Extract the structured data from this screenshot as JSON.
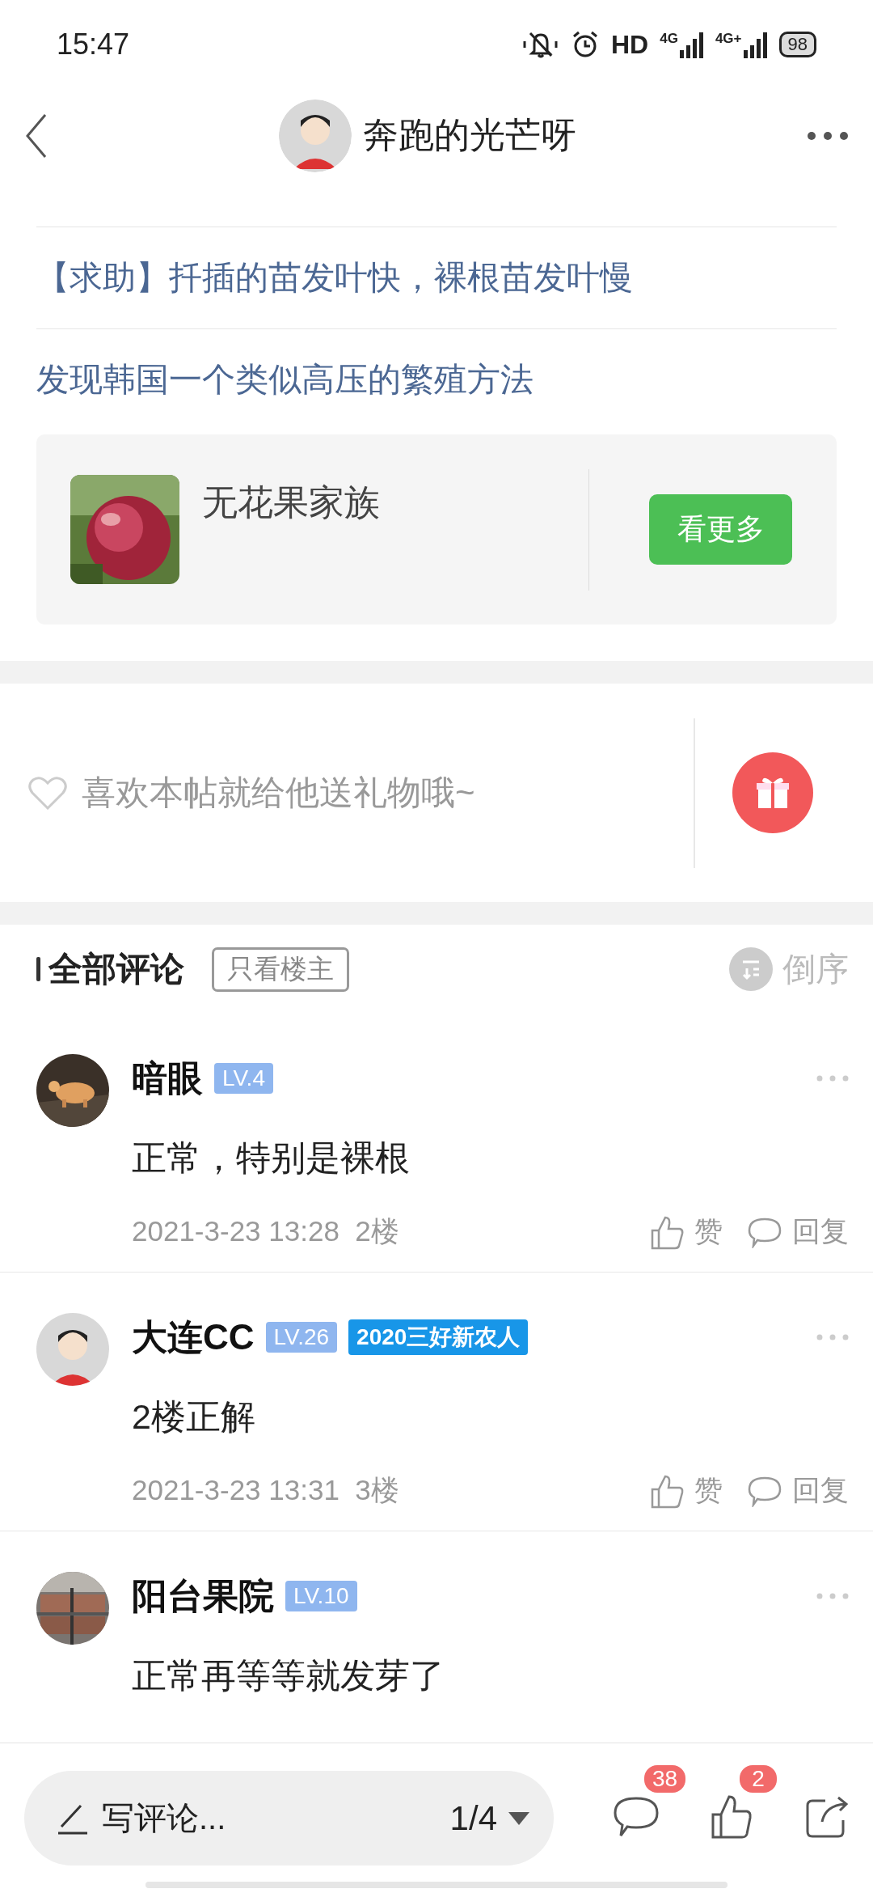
{
  "status_bar": {
    "time": "15:47",
    "hd": "HD",
    "networks": [
      "4G",
      "4G+"
    ],
    "battery": "98"
  },
  "header": {
    "title": "奔跑的光芒呀"
  },
  "related_links": [
    {
      "text": "【求助】扦插的苗发叶快，裸根苗发叶慢"
    },
    {
      "text": "发现韩国一个类似高压的繁殖方法"
    }
  ],
  "forum_card": {
    "name": "无花果家族",
    "button": "看更多"
  },
  "gift": {
    "prompt": "喜欢本帖就给他送礼物哦~"
  },
  "comments_header": {
    "title": "全部评论",
    "filter": "只看楼主",
    "sort": "倒序"
  },
  "comments": [
    {
      "user": "暗眼",
      "badges": [
        {
          "kind": "level",
          "text": "LV.4"
        }
      ],
      "text": "正常，特别是裸根",
      "time": "2021-3-23 13:28",
      "floor": "2楼",
      "like": "赞",
      "reply": "回复"
    },
    {
      "user": "大连CC",
      "badges": [
        {
          "kind": "level",
          "text": "LV.26"
        },
        {
          "kind": "honor",
          "text": "2020三好新农人"
        }
      ],
      "text": "2楼正解",
      "time": "2021-3-23 13:31",
      "floor": "3楼",
      "like": "赞",
      "reply": "回复"
    },
    {
      "user": "阳台果院",
      "badges": [
        {
          "kind": "level",
          "text": "LV.10"
        }
      ],
      "text": "正常再等等就发芽了"
    }
  ],
  "bottom_bar": {
    "placeholder": "写评论...",
    "page": "1/4",
    "comment_count": "38",
    "like_count": "2"
  }
}
